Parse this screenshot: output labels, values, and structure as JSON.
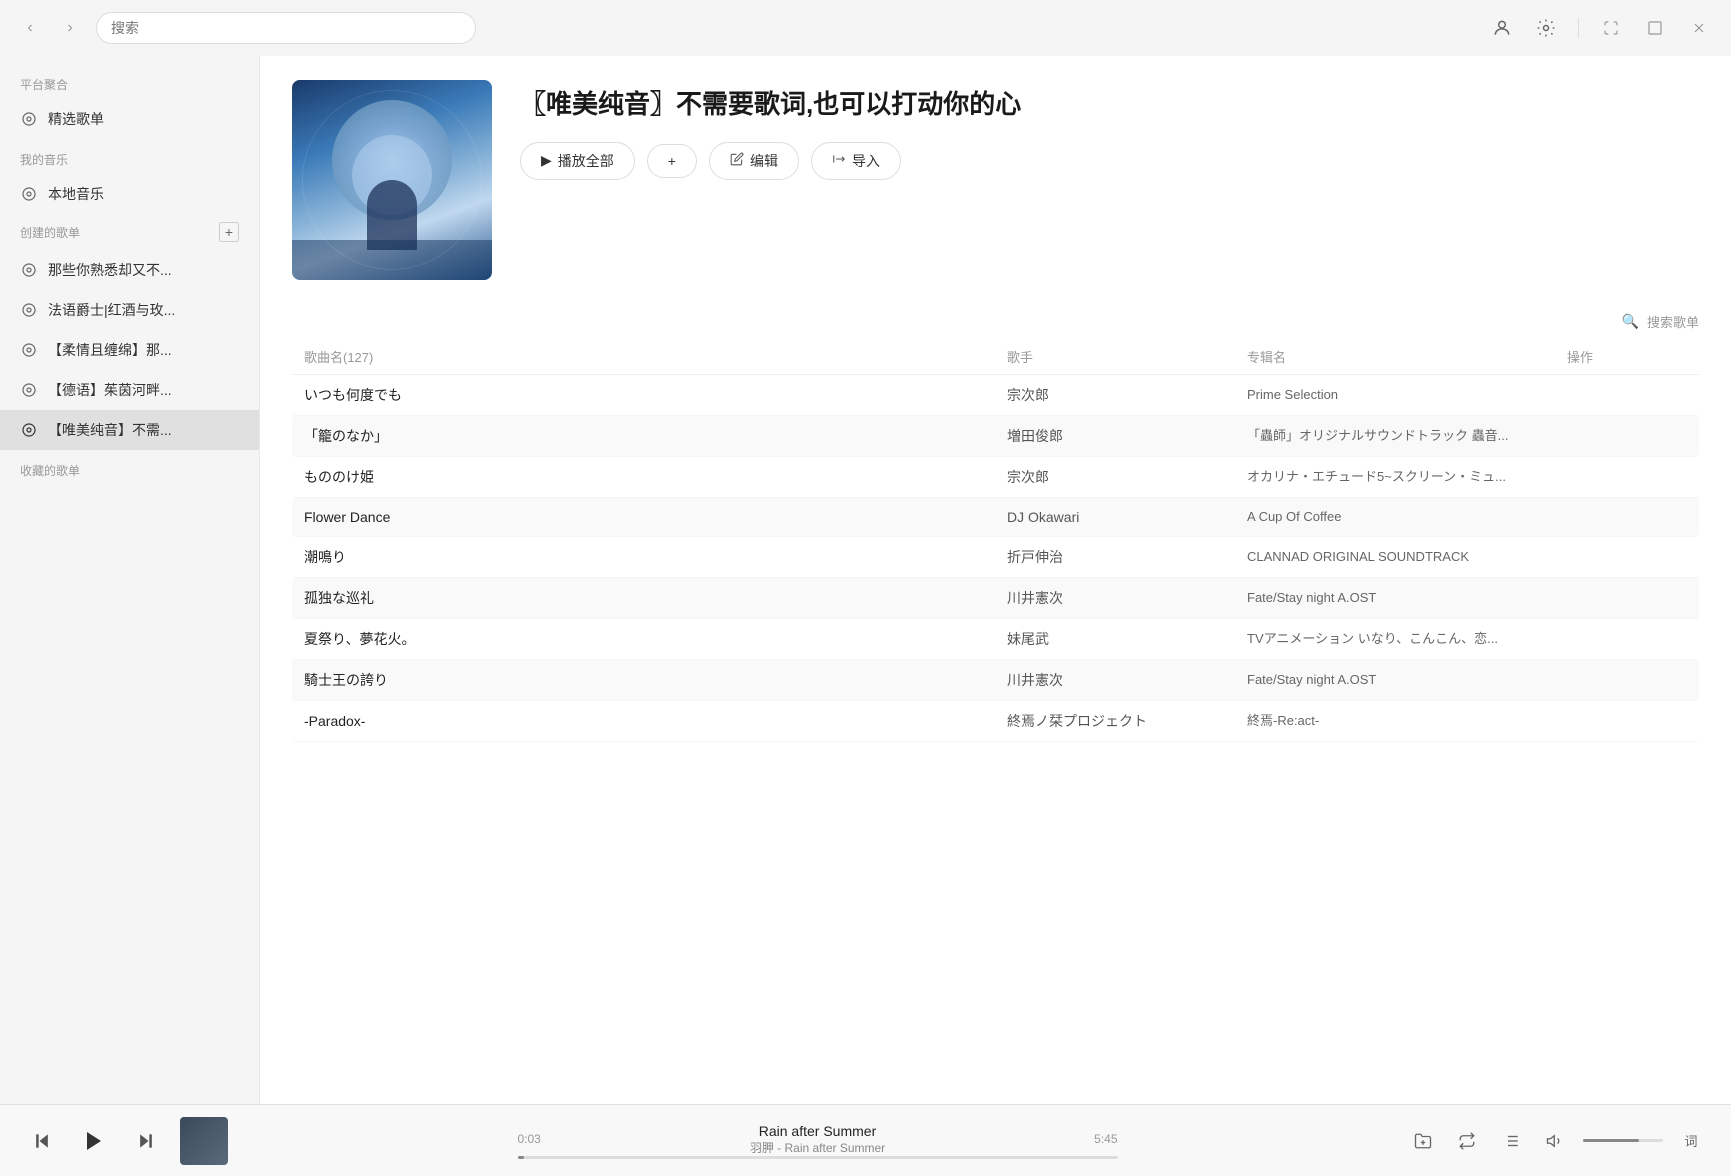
{
  "titlebar": {
    "search_placeholder": "搜索",
    "back_label": "‹",
    "forward_label": "›"
  },
  "sidebar": {
    "platform_label": "平台聚合",
    "my_music_label": "我的音乐",
    "created_playlists_label": "创建的歌单",
    "saved_playlists_label": "收藏的歌单",
    "items": [
      {
        "id": "featured",
        "label": "精选歌单",
        "icon": "◎"
      },
      {
        "id": "local",
        "label": "本地音乐",
        "icon": "◎"
      },
      {
        "id": "playlist1",
        "label": "那些你熟悉却又不...",
        "icon": "◎"
      },
      {
        "id": "playlist2",
        "label": "法语爵士|红酒与玫...",
        "icon": "◎"
      },
      {
        "id": "playlist3",
        "label": "【柔情且缠绵】那...",
        "icon": "◎"
      },
      {
        "id": "playlist4",
        "label": "【德语】茱茵河畔...",
        "icon": "◎"
      },
      {
        "id": "playlist5",
        "label": "【唯美纯音】不需...",
        "icon": "◎",
        "active": true
      }
    ]
  },
  "playlist": {
    "title": "〖唯美纯音〗不需要歌词,也可以打动你的心",
    "actions": {
      "play_all": "播放全部",
      "add": "+",
      "edit": "编辑",
      "import": "导入"
    },
    "song_count_label": "歌曲名(127)",
    "artist_label": "歌手",
    "album_label": "专辑名",
    "ops_label": "操作",
    "search_songs_placeholder": "搜索歌单"
  },
  "tracks": [
    {
      "title": "いつも何度でも",
      "artist": "宗次郎",
      "album": "Prime Selection",
      "alt": false
    },
    {
      "title": "「籠のなか」",
      "artist": "増田俊郎",
      "album": "「蟲師」オリジナルサウンドトラック 蟲音...",
      "alt": true
    },
    {
      "title": "もののけ姫",
      "artist": "宗次郎",
      "album": "オカリナ・エチュード5~スクリーン・ミュ...",
      "alt": false
    },
    {
      "title": "Flower Dance",
      "artist": "DJ Okawari",
      "album": "A Cup Of Coffee",
      "alt": true
    },
    {
      "title": "潮鳴り",
      "artist": "折戸伸治",
      "album": "CLANNAD ORIGINAL SOUNDTRACK",
      "alt": false
    },
    {
      "title": "孤独な巡礼",
      "artist": "川井憲次",
      "album": "Fate/Stay night A.OST",
      "alt": true
    },
    {
      "title": "夏祭り、夢花火。",
      "artist": "妹尾武",
      "album": "TVアニメーション いなり、こんこん、恋...",
      "alt": false
    },
    {
      "title": "騎士王の誇り",
      "artist": "川井憲次",
      "album": "Fate/Stay night A.OST",
      "alt": true
    },
    {
      "title": "-Paradox-",
      "artist": "終焉ノ栞プロジェクト",
      "album": "終焉-Re:act-",
      "alt": false
    }
  ],
  "player": {
    "cover_alt": "Rain after Summer cover",
    "track_name": "Rain after Summer",
    "artist_info": "羽胛 - Rain after Summer",
    "current_time": "0:03",
    "total_time": "5:45",
    "progress_percent": 1
  },
  "icons": {
    "user": "👤",
    "settings": "⚙",
    "minimize": "—",
    "maximize": "□",
    "close": "×",
    "back": "‹",
    "forward": "›",
    "play": "▶",
    "prev": "⏮",
    "next": "⏭",
    "add_to_library": "📁",
    "loop": "↻",
    "lyrics": "词",
    "volume": "🔈",
    "queue": "≡"
  }
}
